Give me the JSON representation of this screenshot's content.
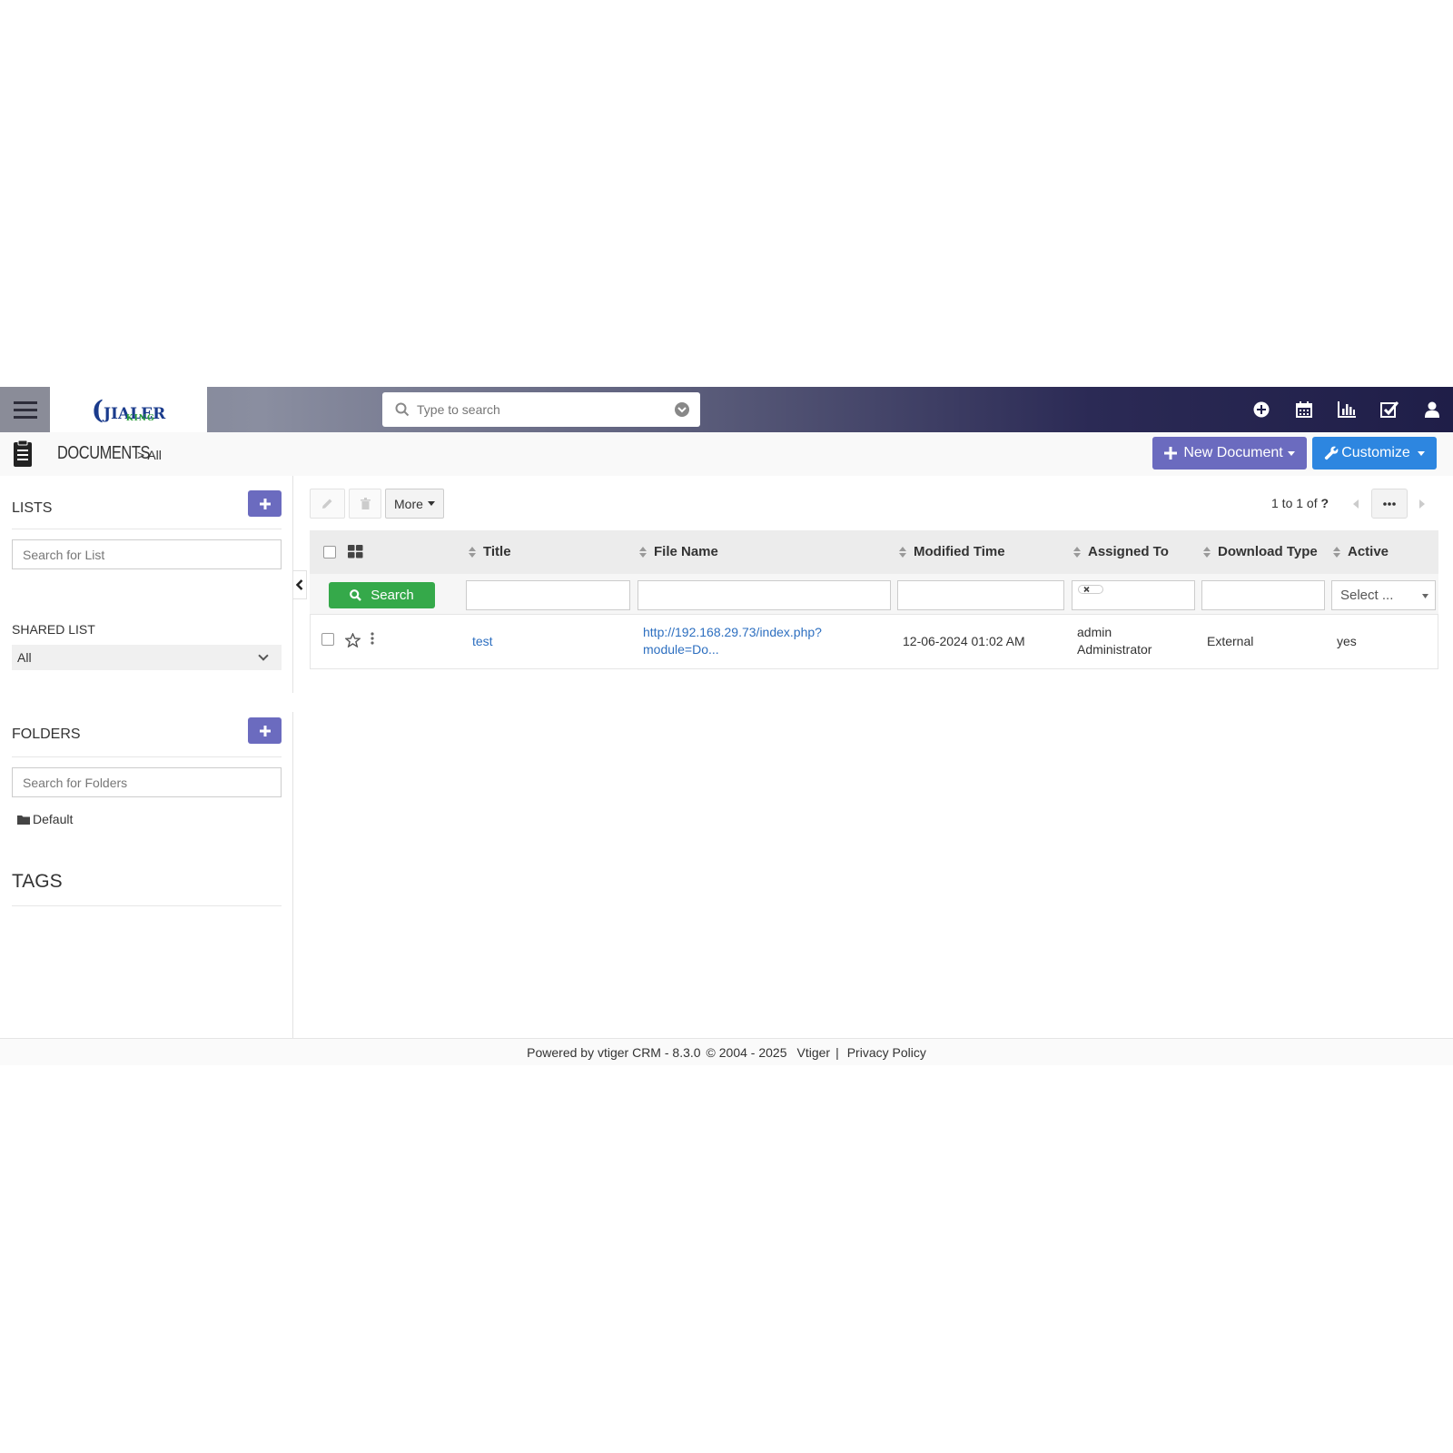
{
  "topbar": {
    "logo_main": "JIALER",
    "logo_sub": "KING",
    "search_placeholder": "Type to search",
    "icons": [
      "plus-circle-icon",
      "calendar-icon",
      "chart-icon",
      "task-check-icon",
      "user-icon"
    ]
  },
  "module": {
    "title": "DOCUMENTS",
    "separator": ">",
    "subtitle": "All",
    "new_button": "New Document",
    "customize_button": "Customize"
  },
  "sidebar": {
    "lists_title": "LISTS",
    "search_list_placeholder": "Search for List",
    "shared_list_label": "SHARED LIST",
    "shared_list_value": "All",
    "folders_title": "FOLDERS",
    "search_folders_placeholder": "Search for Folders",
    "folders": [
      "Default"
    ],
    "tags_title": "TAGS"
  },
  "toolbar": {
    "more_label": "More",
    "pager_text": "1 to 1  of",
    "pager_total": "?"
  },
  "table": {
    "columns": [
      "Title",
      "File Name",
      "Modified Time",
      "Assigned To",
      "Download Type",
      "Active"
    ],
    "search_button": "Search",
    "active_filter_placeholder": "Select ...",
    "rows": [
      {
        "title": "test",
        "file_name_line1": "http://192.168.29.73/index.php?",
        "file_name_line2": "module=Do...",
        "modified_time": "12-06-2024 01:02 AM",
        "assigned_line1": "admin",
        "assigned_line2": "Administrator",
        "download_type": "External",
        "active": "yes"
      }
    ]
  },
  "footer": {
    "powered": "Powered by vtiger CRM - 8.3.0",
    "copyright": "© 2004 - 2025",
    "vtiger": "Vtiger",
    "sep": "|",
    "privacy": "Privacy Policy"
  },
  "colors": {
    "accent_purple": "#6b6bbf",
    "accent_blue": "#2d86e0",
    "search_green": "#35a94a",
    "link_blue": "#2d6fc0"
  }
}
